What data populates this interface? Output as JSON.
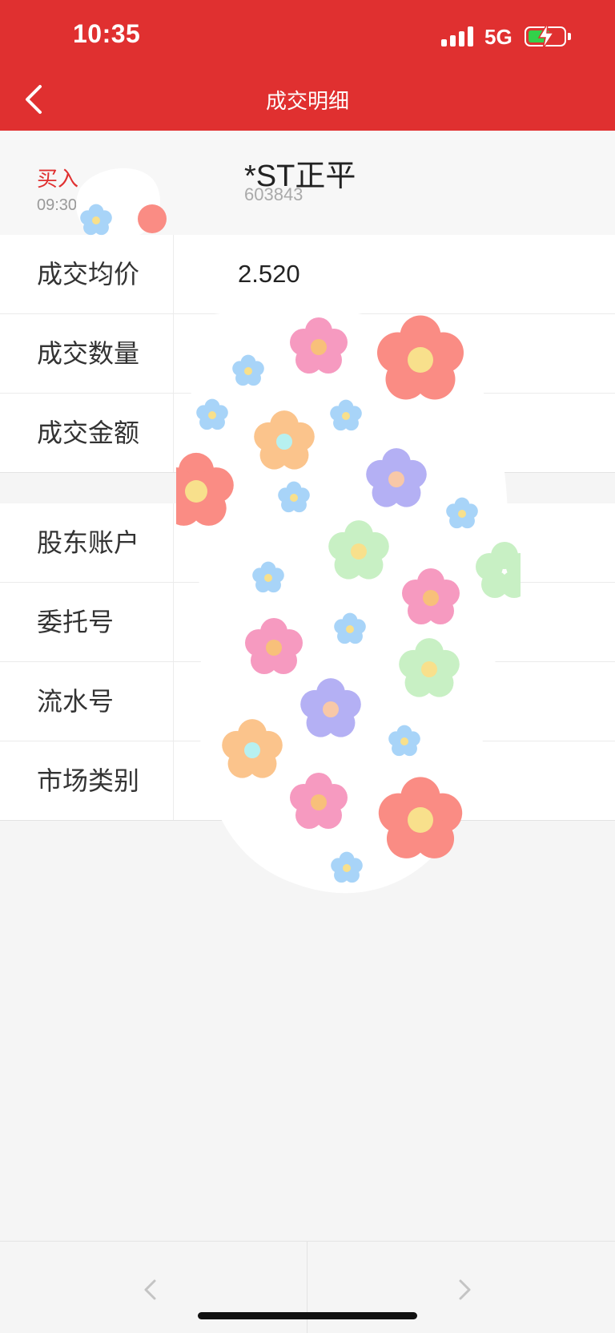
{
  "status_bar": {
    "time": "10:35",
    "network": "5G"
  },
  "nav": {
    "title": "成交明细"
  },
  "trade": {
    "side": "买入",
    "time": "09:30",
    "stock_name": "*ST正平",
    "stock_code": "603843"
  },
  "details": [
    {
      "label": "成交均价",
      "value": "2.520"
    },
    {
      "label": "成交数量",
      "value": ""
    },
    {
      "label": "成交金额",
      "value": ""
    }
  ],
  "account": [
    {
      "label": "股东账户",
      "value": ""
    },
    {
      "label": "委托号",
      "value": ""
    },
    {
      "label": "流水号",
      "value": ""
    },
    {
      "label": "市场类别",
      "value": ""
    }
  ],
  "colors": {
    "brand_red": "#e03030",
    "buy_red": "#e03030",
    "battery_green": "#33d04a"
  },
  "icons": {
    "back": "chevron-left-icon",
    "prev": "chevron-left-icon",
    "next": "chevron-right-icon"
  }
}
